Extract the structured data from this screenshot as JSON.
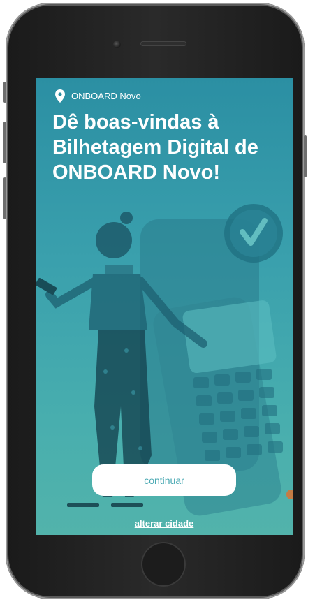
{
  "location": {
    "city": "ONBOARD Novo",
    "icon": "map-pin-icon"
  },
  "welcome": {
    "title": "Dê boas-vindas à Bilhetagem Digital de ONBOARD Novo!"
  },
  "actions": {
    "continue_label": "continuar",
    "change_city_label": "alterar cidade"
  },
  "colors": {
    "accent": "#2b8fa3",
    "text": "#ffffff",
    "button_text": "#4aa9b3"
  }
}
